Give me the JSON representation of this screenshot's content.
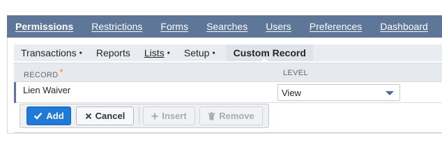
{
  "main_tabs": [
    {
      "label": "Permissions",
      "active": true
    },
    {
      "label": "Restrictions"
    },
    {
      "label": "Forms"
    },
    {
      "label": "Searches"
    },
    {
      "label": "Users"
    },
    {
      "label": "Preferences"
    },
    {
      "label": "Dashboard"
    }
  ],
  "sub_tabs": [
    {
      "label": "Transactions",
      "dot": "•"
    },
    {
      "label": "Reports",
      "dot": ""
    },
    {
      "label": "Lists",
      "dot": "•"
    },
    {
      "label": "Setup",
      "dot": "•"
    },
    {
      "label": "Custom Record",
      "dot": "",
      "active": true
    }
  ],
  "grid": {
    "headers": {
      "record": "RECORD",
      "required_mark": "*",
      "level": "LEVEL"
    },
    "row": {
      "record": "Lien Waiver",
      "level": "View"
    }
  },
  "actions": {
    "add": "Add",
    "cancel": "Cancel",
    "insert": "Insert",
    "remove": "Remove"
  },
  "colors": {
    "tab_bar": "#5e7698",
    "primary_button": "#1f7ad8",
    "required": "#e68a00"
  },
  "icons": {
    "add": "check-icon",
    "cancel": "x-icon",
    "insert": "plus-icon",
    "remove": "trash-icon",
    "select": "chevron-down-icon"
  }
}
